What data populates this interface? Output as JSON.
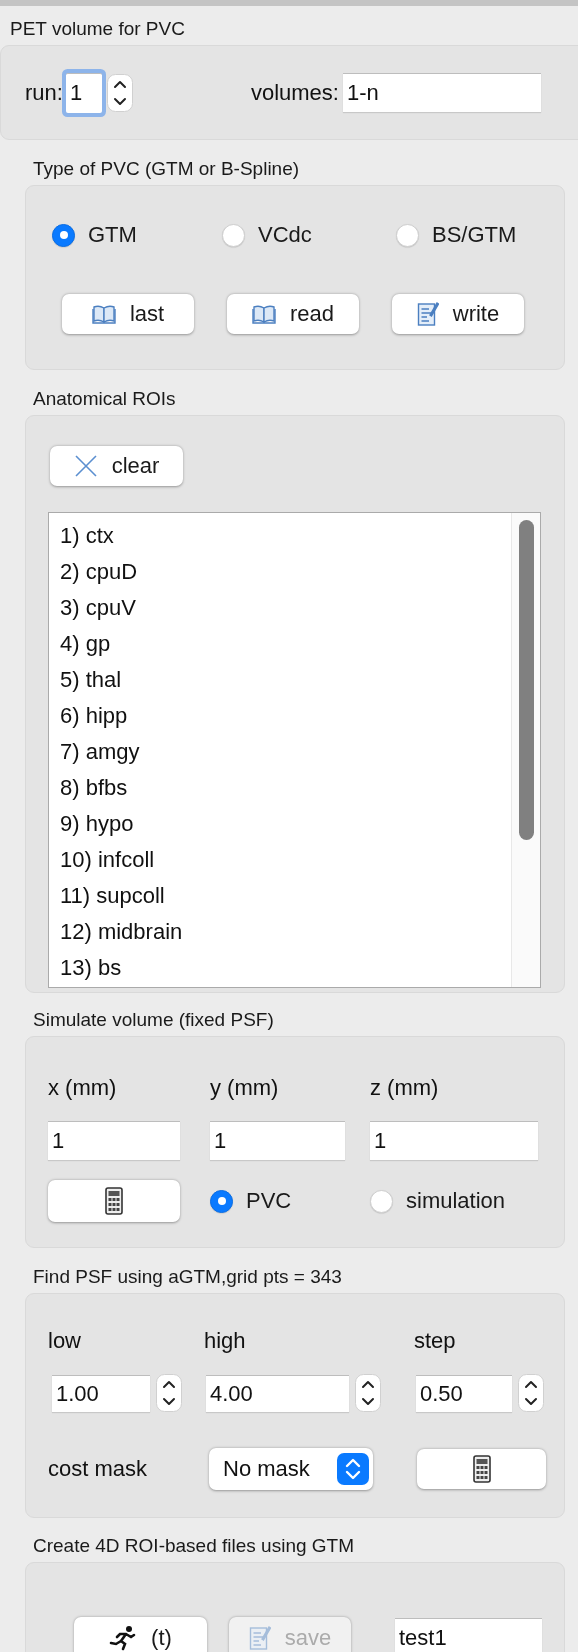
{
  "pet_volume": {
    "title": "PET volume for PVC",
    "run_label": "run:",
    "run_field": {
      "value": "1",
      "focused": true
    },
    "volumes_label": "volumes:",
    "volumes_field": {
      "value": "1-n"
    }
  },
  "pvc_type": {
    "title": "Type of PVC (GTM or B-Spline)",
    "options": [
      {
        "label": "GTM",
        "selected": true
      },
      {
        "label": "VCdc",
        "selected": false
      },
      {
        "label": "BS/GTM",
        "selected": false
      }
    ],
    "buttons": [
      {
        "label": "last"
      },
      {
        "label": "read"
      },
      {
        "label": "write"
      }
    ]
  },
  "anatomical_rois": {
    "title": "Anatomical ROIs",
    "clear_button": "clear",
    "items": [
      "1) ctx",
      "2) cpuD",
      "3) cpuV",
      "4) gp",
      "5) thal",
      "6) hipp",
      "7) amgy",
      "8) bfbs",
      "9) hypo",
      "10) infcoll",
      "11) supcoll",
      "12) midbrain",
      "13) bs"
    ]
  },
  "simulate_volume": {
    "title": "Simulate volume (fixed PSF)",
    "fields": [
      {
        "label": "x (mm)",
        "value": "1"
      },
      {
        "label": "y (mm)",
        "value": "1"
      },
      {
        "label": "z (mm)",
        "value": "1"
      }
    ],
    "modes": [
      {
        "label": "PVC",
        "selected": true
      },
      {
        "label": "simulation",
        "selected": false
      }
    ]
  },
  "find_psf": {
    "title": "Find PSF using aGTM,grid pts = 343",
    "fields": [
      {
        "label": "low",
        "value": "1.00"
      },
      {
        "label": "high",
        "value": "4.00"
      },
      {
        "label": "step",
        "value": "0.50"
      }
    ],
    "cost_mask_label": "cost mask",
    "cost_mask": "No mask"
  },
  "create_4d": {
    "title": "Create 4D ROI-based files using GTM",
    "buttons": [
      {
        "label": "(t)",
        "disabled": false
      },
      {
        "label": "save",
        "disabled": true
      }
    ],
    "file_field": "test1"
  }
}
